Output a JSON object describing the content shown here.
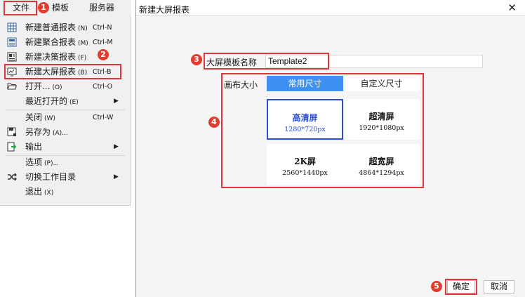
{
  "menubar": {
    "items": [
      {
        "label": "文件"
      },
      {
        "label": "模板"
      },
      {
        "label": "服务器"
      }
    ]
  },
  "menu": {
    "items": [
      {
        "label": "新建普通报表",
        "mn": "(N)",
        "shortcut": "Ctrl-N",
        "icon": "grid-report-icon"
      },
      {
        "label": "新建聚合报表",
        "mn": "(M)",
        "shortcut": "Ctrl-M",
        "icon": "aggregate-report-icon"
      },
      {
        "label": "新建决策报表",
        "mn": "(F)",
        "shortcut": "",
        "icon": "decision-report-icon"
      },
      {
        "label": "新建大屏报表",
        "mn": "(B)",
        "shortcut": "Ctrl-B",
        "icon": "big-screen-icon"
      },
      {
        "label": "打开...",
        "mn": "(O)",
        "shortcut": "Ctrl-O",
        "icon": "folder-open-icon"
      },
      {
        "label": "最近打开的",
        "mn": "(E)",
        "shortcut": "",
        "icon": ""
      },
      {
        "label": "关闭",
        "mn": "(W)",
        "shortcut": "Ctrl-W",
        "icon": ""
      },
      {
        "label": "另存为",
        "mn": "(A)...",
        "shortcut": "",
        "icon": "save-as-icon"
      },
      {
        "label": "输出",
        "mn": "",
        "shortcut": "",
        "icon": "export-icon"
      },
      {
        "label": "选项",
        "mn": "(P)...",
        "shortcut": "",
        "icon": ""
      },
      {
        "label": "切换工作目录",
        "mn": "",
        "shortcut": "",
        "icon": "switch-icon"
      },
      {
        "label": "退出",
        "mn": "(X)",
        "shortcut": "",
        "icon": ""
      }
    ]
  },
  "badges": [
    "1",
    "2",
    "3",
    "4",
    "5"
  ],
  "dialog": {
    "title": "新建大屏报表",
    "close_glyph": "✕",
    "name_label": "大屏模板名称",
    "name_value": "Template2",
    "canvas_label": "画布大小",
    "tabs": [
      {
        "label": "常用尺寸"
      },
      {
        "label": "自定义尺寸"
      }
    ],
    "sizes": [
      {
        "name": "高清屏",
        "dims": "1280*720px"
      },
      {
        "name": "超清屏",
        "dims": "1920*1080px"
      },
      {
        "name": "2K屏",
        "dims": "2560*1440px"
      },
      {
        "name": "超宽屏",
        "dims": "4864*1294px"
      }
    ],
    "ok_label": "确定",
    "cancel_label": "取消"
  },
  "colors": {
    "annotation_red": "#e0353b",
    "tab_active": "#3e90f2",
    "selected_card": "#2d4fd8"
  }
}
